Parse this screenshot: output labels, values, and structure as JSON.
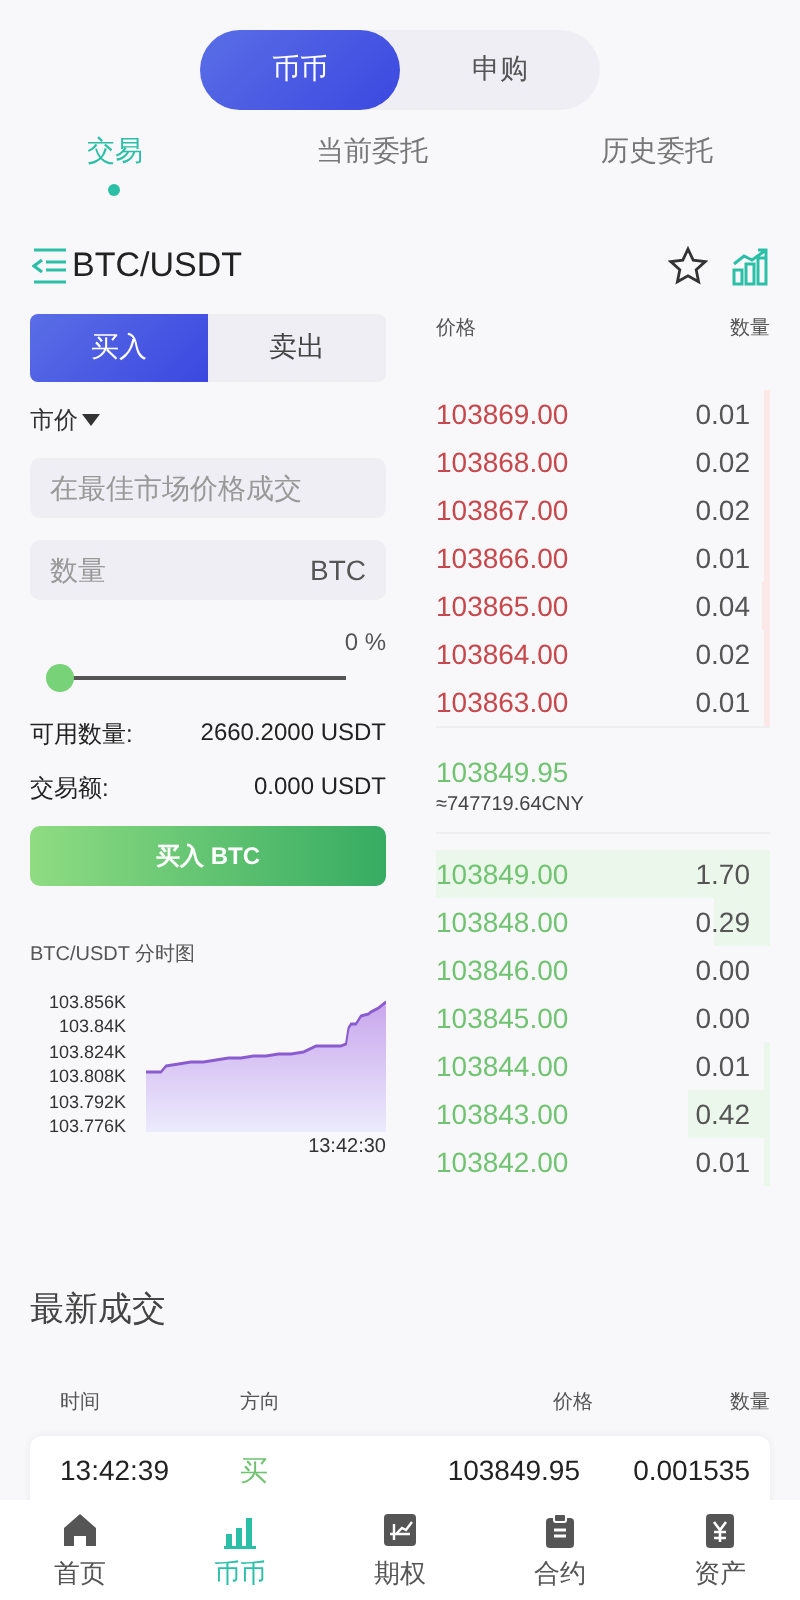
{
  "mode_switch": [
    {
      "label": "币币",
      "selected": true
    },
    {
      "label": "申购",
      "selected": false
    }
  ],
  "tabs": [
    {
      "label": "交易",
      "selected": true
    },
    {
      "label": "当前委托",
      "selected": false
    },
    {
      "label": "历史委托",
      "selected": false
    }
  ],
  "pair": {
    "title": "BTC/USDT",
    "favorite": false
  },
  "order_form": {
    "sides": [
      {
        "label": "买入",
        "selected": true
      },
      {
        "label": "卖出",
        "selected": false
      }
    ],
    "order_type": "市价",
    "price_field": {
      "placeholder": "在最佳市场价格成交"
    },
    "amount_field": {
      "placeholder": "数量",
      "unit": "BTC"
    },
    "slider": {
      "level": 0,
      "reading": "0 %"
    },
    "stats": [
      {
        "label": "可用数量:",
        "value": "2660.2000 USDT"
      },
      {
        "label": "交易额:",
        "value": "0.000 USDT"
      }
    ],
    "submit": "买入 BTC"
  },
  "mini_chart": {
    "title": "BTC/USDT 分时图",
    "y_labels": [
      "103.856K",
      "103.84K",
      "103.824K",
      "103.808K",
      "103.792K",
      "103.776K"
    ],
    "time_label": "13:42:30"
  },
  "order_book": {
    "columns": [
      "价格",
      "数量"
    ],
    "asks": [
      {
        "price": "103869.00",
        "amount": "0.01"
      },
      {
        "price": "103868.00",
        "amount": "0.02"
      },
      {
        "price": "103867.00",
        "amount": "0.02"
      },
      {
        "price": "103866.00",
        "amount": "0.01"
      },
      {
        "price": "103865.00",
        "amount": "0.04"
      },
      {
        "price": "103864.00",
        "amount": "0.02"
      },
      {
        "price": "103863.00",
        "amount": "0.01"
      }
    ],
    "last_price": "103849.95",
    "last_price_cny": "≈747719.64CNY",
    "bids": [
      {
        "price": "103849.00",
        "amount": "1.70"
      },
      {
        "price": "103848.00",
        "amount": "0.29"
      },
      {
        "price": "103846.00",
        "amount": "0.00"
      },
      {
        "price": "103845.00",
        "amount": "0.00"
      },
      {
        "price": "103844.00",
        "amount": "0.01"
      },
      {
        "price": "103843.00",
        "amount": "0.42"
      },
      {
        "price": "103842.00",
        "amount": "0.01"
      }
    ]
  },
  "latest_trades": {
    "title": "最新成交",
    "columns": [
      "时间",
      "方向",
      "价格",
      "数量"
    ],
    "rows": [
      {
        "time": "13:42:39",
        "side": "买",
        "kind": "buy",
        "price": "103849.95",
        "amount": "0.001535"
      }
    ]
  },
  "bottom_nav": [
    {
      "label": "首页",
      "selected": false
    },
    {
      "label": "币币",
      "selected": true
    },
    {
      "label": "期权",
      "selected": false
    },
    {
      "label": "合约",
      "selected": false
    },
    {
      "label": "资产",
      "selected": false
    }
  ]
}
